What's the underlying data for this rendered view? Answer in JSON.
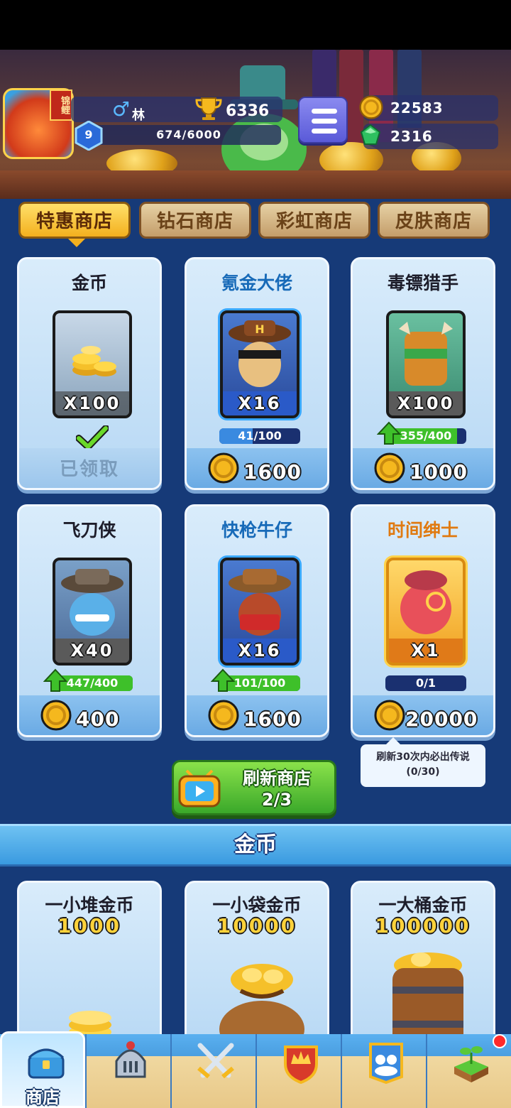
{
  "header": {
    "avatar_tag": "锦鲤",
    "player_name": "林",
    "trophies": "6336",
    "level": "9",
    "xp": "674/6000",
    "coins": "22583",
    "gems": "2316"
  },
  "tabs": [
    {
      "label": "特惠商店",
      "active": true
    },
    {
      "label": "钻石商店",
      "active": false
    },
    {
      "label": "彩虹商店",
      "active": false
    },
    {
      "label": "皮肤商店",
      "active": false
    }
  ],
  "offers": [
    {
      "title": "金币",
      "qty": "X100",
      "claimed_label": "已领取"
    },
    {
      "title": "氪金大佬",
      "qty": "X16",
      "progress": "41/100",
      "progress_value": 0.41,
      "price": "1600"
    },
    {
      "title": "毒镖猎手",
      "qty": "X100",
      "progress": "355/400",
      "progress_value": 0.89,
      "price": "1000"
    },
    {
      "title": "飞刀侠",
      "qty": "X40",
      "progress": "447/400",
      "progress_value": 1.0,
      "price": "400"
    },
    {
      "title": "快枪牛仔",
      "qty": "X16",
      "progress": "101/100",
      "progress_value": 1.0,
      "price": "1600"
    },
    {
      "title": "时间绅士",
      "qty": "X1",
      "progress": "0/1",
      "progress_value": 0,
      "price": "20000"
    }
  ],
  "tooltip": {
    "line1": "刷新30次内必出传说",
    "line2": "(0/30)"
  },
  "refresh": {
    "label": "刷新商店",
    "count": "2/3"
  },
  "section_title": "金币",
  "coin_packs": [
    {
      "title": "一小堆金币",
      "amount": "1000"
    },
    {
      "title": "一小袋金币",
      "amount": "10000"
    },
    {
      "title": "一大桶金币",
      "amount": "100000"
    }
  ],
  "nav": {
    "shop_label": "商店"
  },
  "colors": {
    "panel": "#163a78",
    "accent_gold": "#f3b01e",
    "button_green": "#3aa82a"
  }
}
